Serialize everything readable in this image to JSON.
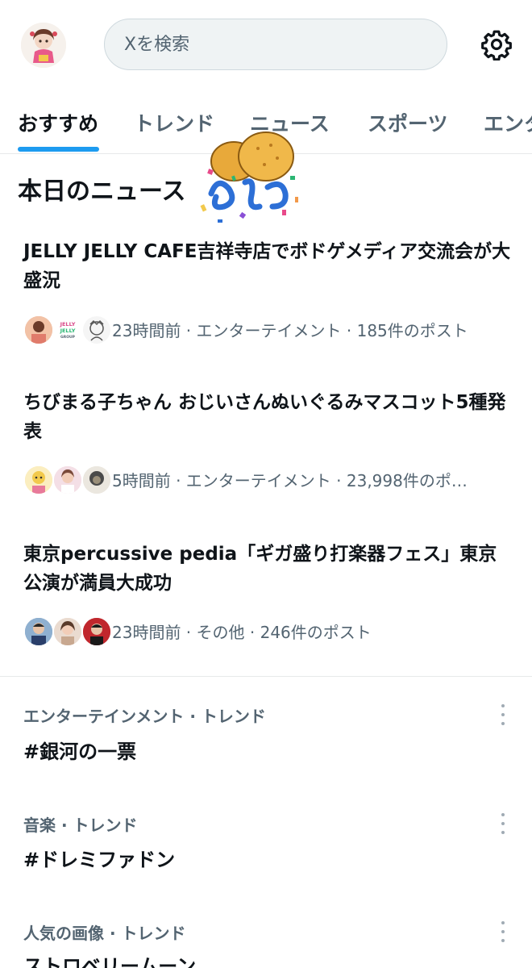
{
  "search": {
    "placeholder": "Xを検索"
  },
  "tabs": [
    {
      "label": "おすすめ",
      "active": true
    },
    {
      "label": "トレンド"
    },
    {
      "label": "ニュース"
    },
    {
      "label": "スポーツ"
    },
    {
      "label": "エンタ"
    }
  ],
  "section": {
    "title": "本日のニュース"
  },
  "news": [
    {
      "title": "JELLY JELLY CAFE吉祥寺店でボドゲメディア交流会が大盛況",
      "meta": "23時間前 · エンターテイメント · 185件のポスト",
      "avatar_logo_text": "JELLY JELLY GROUP"
    },
    {
      "title": "ちびまる子ちゃん おじいさんぬいぐるみマスコット5種発表",
      "meta": "5時間前 · エンターテイメント · 23,998件のポ…"
    },
    {
      "title": "東京percussive pedia「ギガ盛り打楽器フェス」東京公演が満員大成功",
      "meta": "23時間前 · その他 · 246件のポスト"
    }
  ],
  "trends": [
    {
      "category": "エンターテインメント · トレンド",
      "name": "#銀河の一票"
    },
    {
      "category": "音楽 · トレンド",
      "name": "#ドレミファドン"
    },
    {
      "category": "人気の画像 · トレンド",
      "name": "ストロベリームーン"
    }
  ],
  "colors": {
    "accent": "#1d9bf0",
    "text_primary": "#0f1419",
    "text_secondary": "#536471",
    "divider": "#e7e9ea"
  },
  "icons": {
    "settings": "gear-icon",
    "more": "more-vertical-icon"
  }
}
